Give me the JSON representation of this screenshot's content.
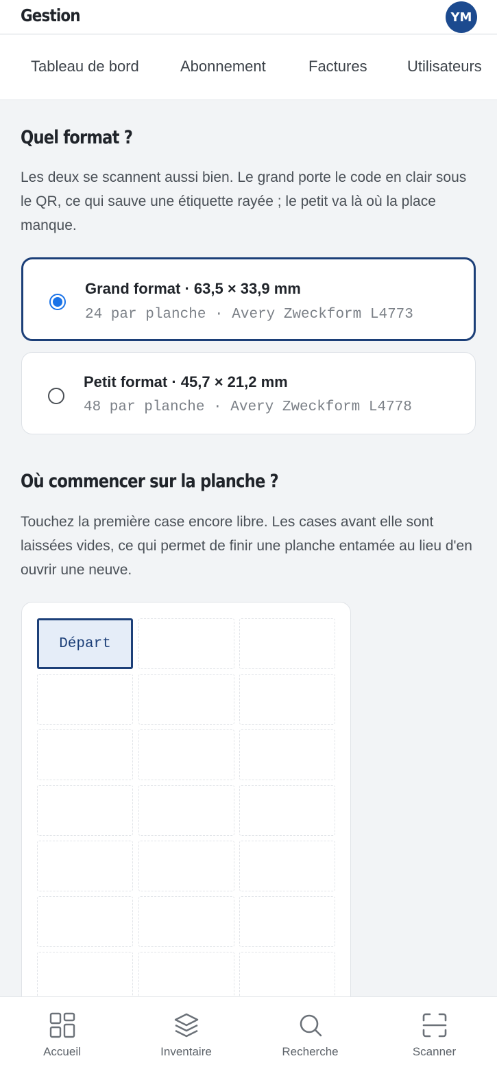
{
  "header": {
    "title": "Gestion",
    "avatar_initials": "YM"
  },
  "tabs": [
    {
      "label": "Tableau de bord"
    },
    {
      "label": "Abonnement"
    },
    {
      "label": "Factures"
    },
    {
      "label": "Utilisateurs"
    }
  ],
  "format_section": {
    "heading": "Quel format ?",
    "description": "Les deux se scannent aussi bien. Le grand porte le code en clair sous le QR, ce qui sauve une étiquette rayée ; le petit va là où la place manque.",
    "options": [
      {
        "title": "Grand format · 63,5 × 33,9 mm",
        "subtitle": "24 par planche · Avery Zweckform L4773",
        "selected": true
      },
      {
        "title": "Petit format · 45,7 × 21,2 mm",
        "subtitle": "48 par planche · Avery Zweckform L4778",
        "selected": false
      }
    ]
  },
  "start_section": {
    "heading": "Où commencer sur la planche ?",
    "description": "Touchez la première case encore libre. Les cases avant elle sont laissées vides, ce qui permet de finir une planche entamée au lieu d'en ouvrir une neuve.",
    "start_label": "Départ"
  },
  "bottom_nav": [
    {
      "label": "Accueil",
      "icon": "grid-icon"
    },
    {
      "label": "Inventaire",
      "icon": "layers-icon"
    },
    {
      "label": "Recherche",
      "icon": "search-icon"
    },
    {
      "label": "Scanner",
      "icon": "scan-icon"
    }
  ],
  "colors": {
    "accent": "#1c3f78",
    "radio": "#1a73e8",
    "background": "#f2f4f6"
  }
}
